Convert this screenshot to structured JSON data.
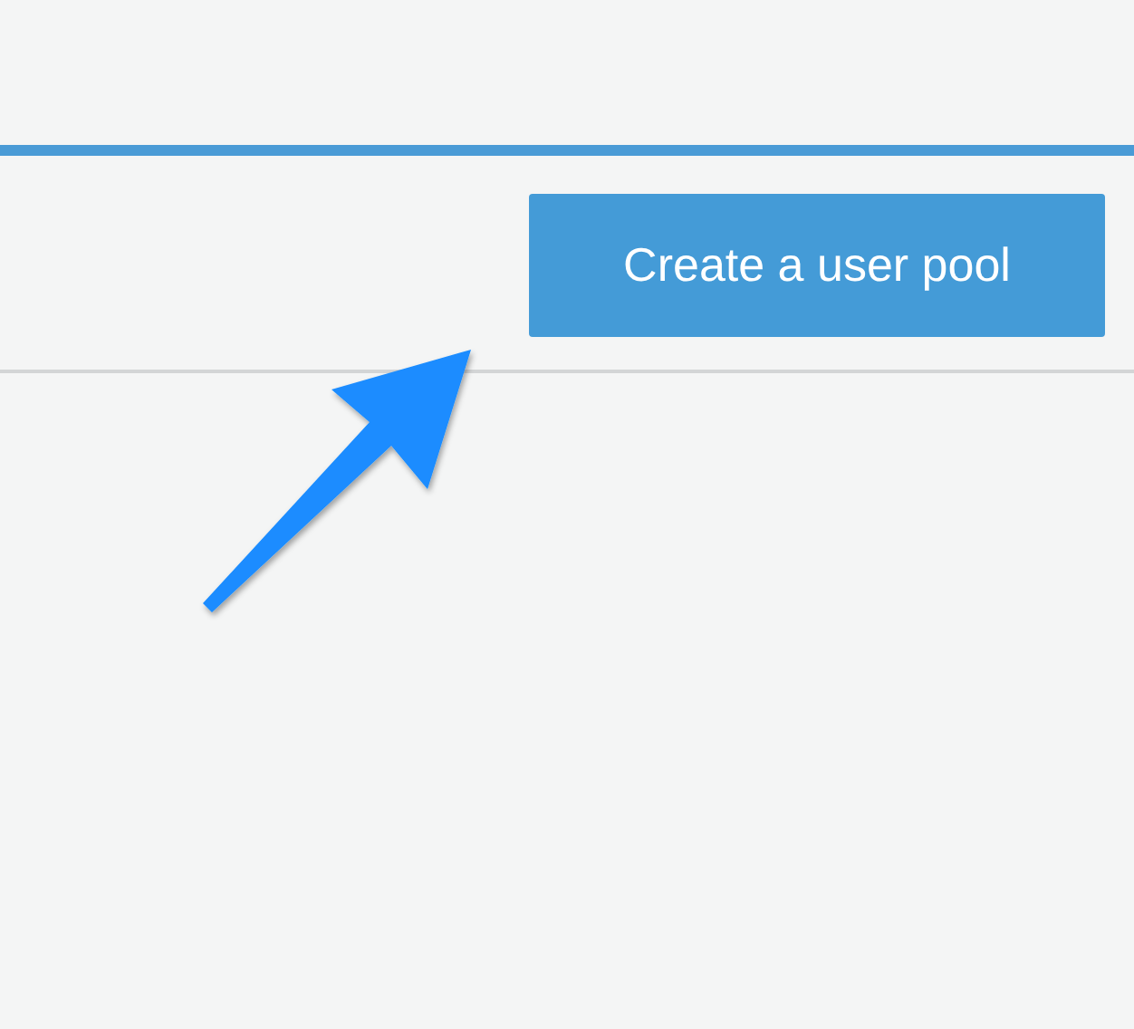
{
  "toolbar": {
    "button": {
      "label": "Create a user pool"
    }
  }
}
